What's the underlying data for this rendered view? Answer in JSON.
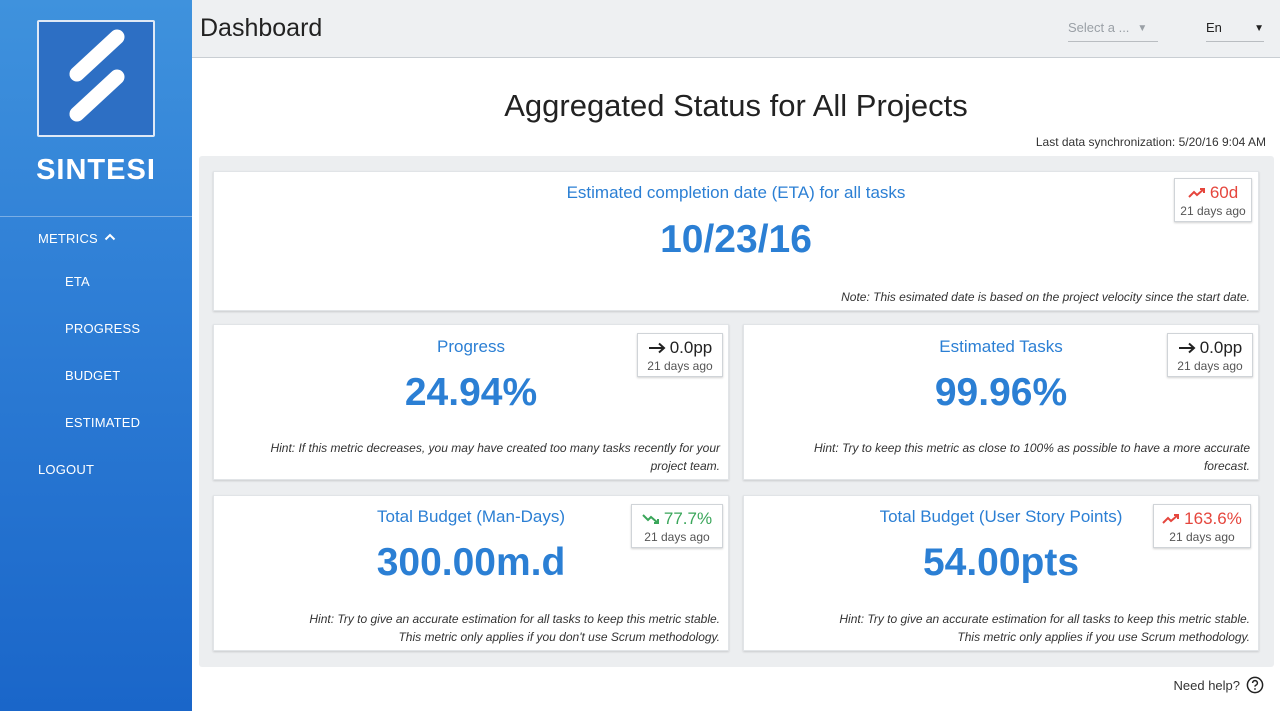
{
  "sidebar": {
    "brand": "SINTESI",
    "metrics_label": "METRICS",
    "items": [
      {
        "label": "ETA"
      },
      {
        "label": "PROGRESS"
      },
      {
        "label": "BUDGET"
      },
      {
        "label": "ESTIMATED"
      }
    ],
    "logout_label": "LOGOUT"
  },
  "header": {
    "title": "Dashboard",
    "project_select": "Select a ...",
    "language": "En"
  },
  "main": {
    "title": "Aggregated Status for All Projects",
    "sync": "Last data synchronization: 5/20/16 9:04 AM"
  },
  "cards": {
    "eta": {
      "title": "Estimated completion date (ETA) for all tasks",
      "value": "10/23/16",
      "note": "Note: This esimated date is based on the project velocity since the start date.",
      "badge": {
        "value": "60d",
        "ago": "21 days ago",
        "trend": "up",
        "color": "#e5463d"
      }
    },
    "progress": {
      "title": "Progress",
      "value": "24.94%",
      "hint_line1": "Hint: If this metric decreases, you may have created too many tasks recently for your",
      "hint_line2": "project team.",
      "badge": {
        "value": "0.0pp",
        "ago": "21 days ago",
        "trend": "flat",
        "color": "#222222"
      }
    },
    "estimated": {
      "title": "Estimated Tasks",
      "value": "99.96%",
      "hint_line1": "Hint: Try to keep this metric as close to 100% as possible to have a more accurate",
      "hint_line2": "forecast.",
      "badge": {
        "value": "0.0pp",
        "ago": "21 days ago",
        "trend": "flat",
        "color": "#222222"
      }
    },
    "budget_md": {
      "title": "Total Budget (Man-Days)",
      "value": "300.00m.d",
      "hint_line1": "Hint: Try to give an accurate estimation for all tasks to keep this metric stable.",
      "hint_line2": "This metric only applies if you don't use Scrum methodology.",
      "badge": {
        "value": "77.7%",
        "ago": "21 days ago",
        "trend": "down",
        "color": "#3aa65a"
      }
    },
    "budget_usp": {
      "title": "Total Budget (User Story Points)",
      "value": "54.00pts",
      "hint_line1": "Hint: Try to give an accurate estimation for all tasks to keep this metric stable.",
      "hint_line2": "This metric only applies if you use Scrum methodology.",
      "badge": {
        "value": "163.6%",
        "ago": "21 days ago",
        "trend": "up",
        "color": "#e5463d"
      }
    }
  },
  "footer": {
    "help": "Need help?"
  }
}
